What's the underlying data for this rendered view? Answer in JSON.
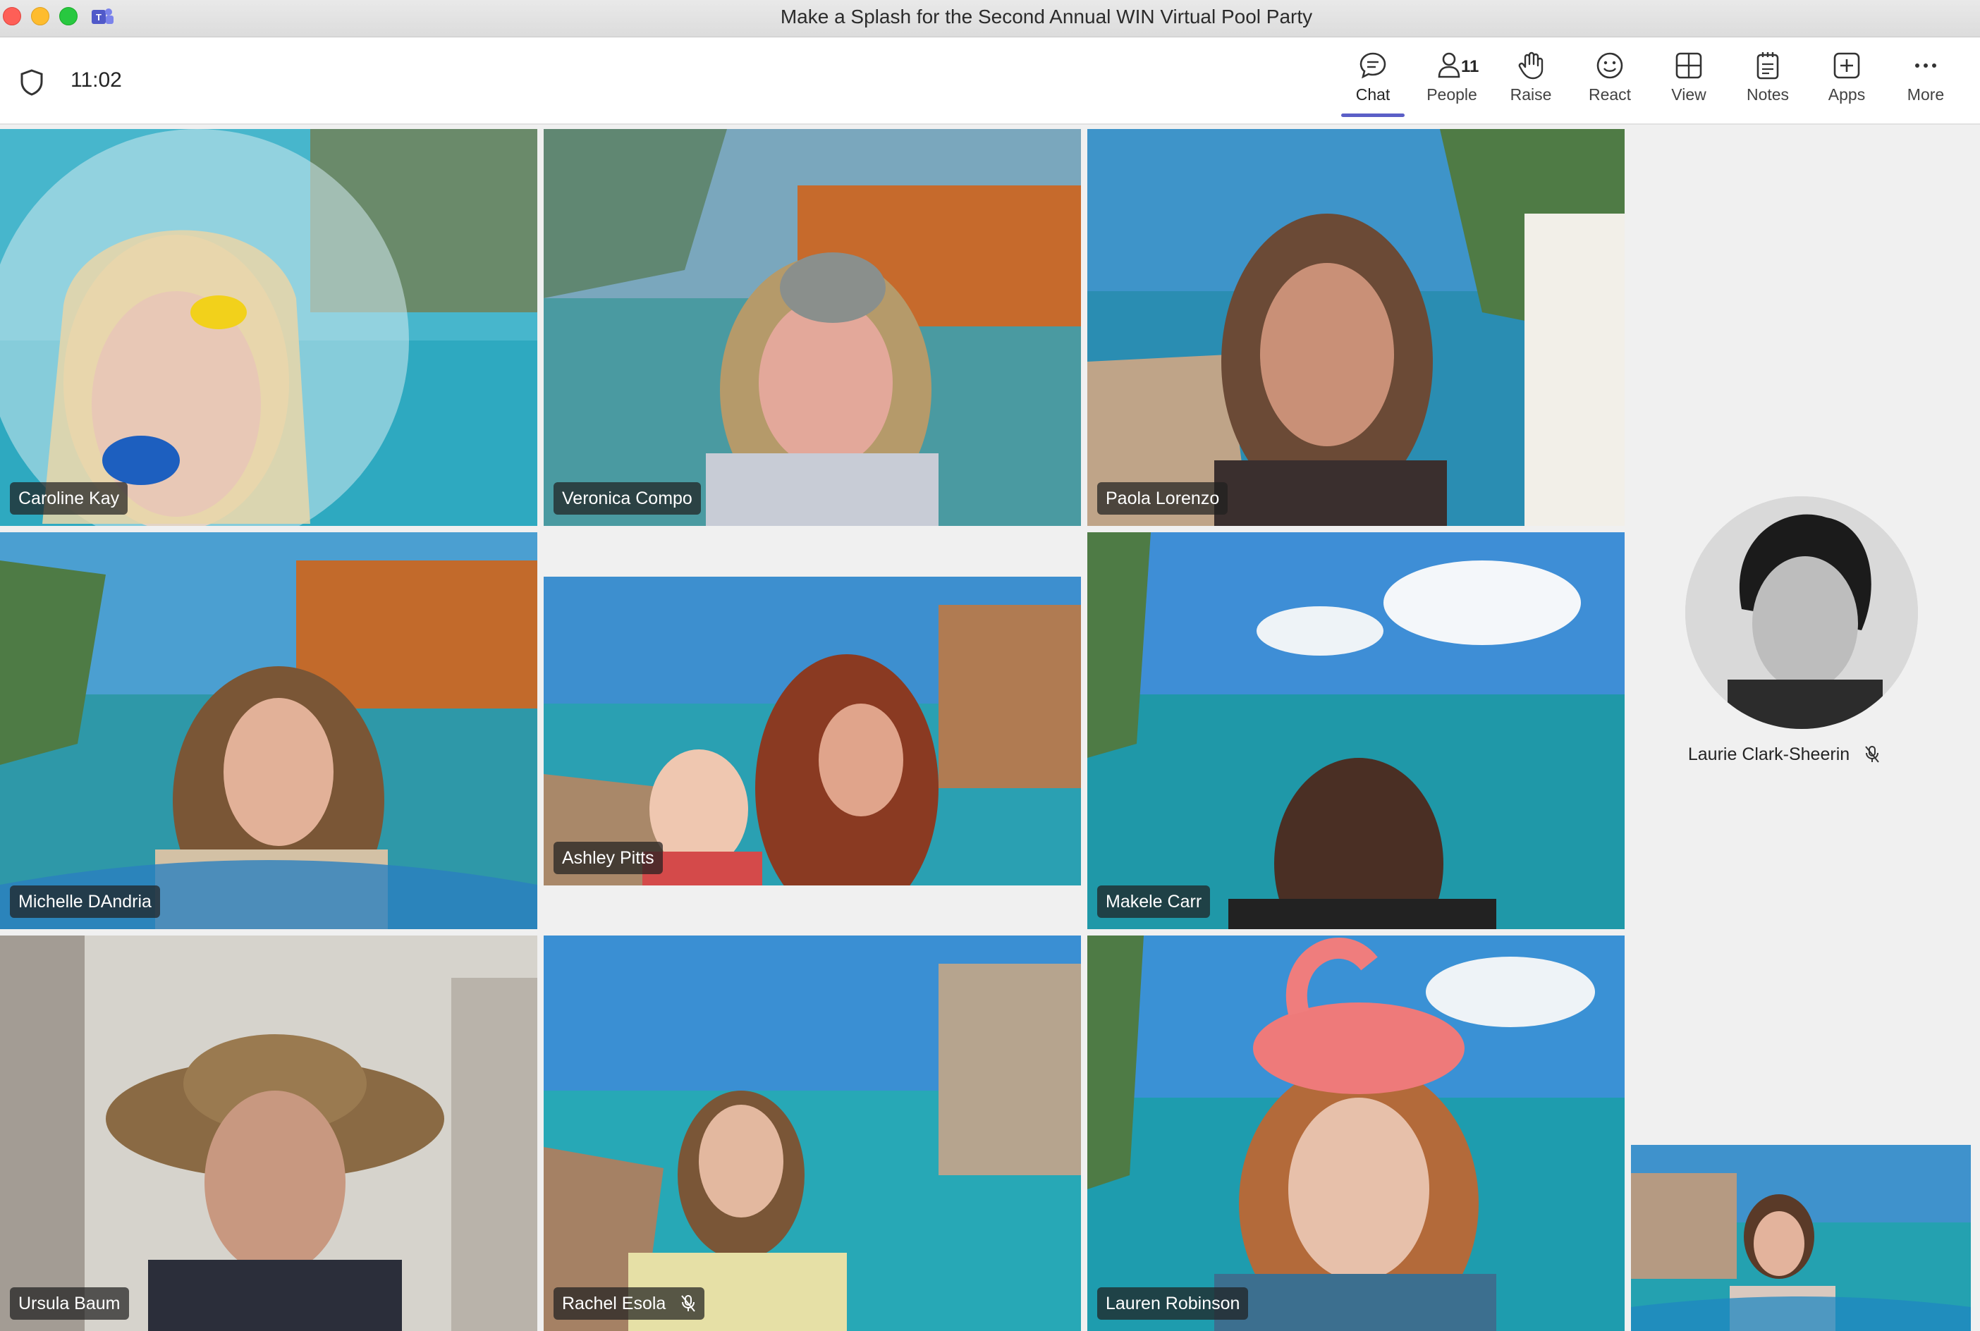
{
  "window": {
    "title": "Make a Splash for the Second Annual WIN Virtual Pool Party"
  },
  "toolbar": {
    "elapsed_time": "11:02",
    "people_count": "11",
    "buttons": [
      {
        "label": "Chat",
        "icon": "chat-icon",
        "active": true
      },
      {
        "label": "People",
        "icon": "people-icon"
      },
      {
        "label": "Raise",
        "icon": "raise-hand-icon"
      },
      {
        "label": "React",
        "icon": "react-icon"
      },
      {
        "label": "View",
        "icon": "view-grid-icon"
      },
      {
        "label": "Notes",
        "icon": "notes-icon"
      },
      {
        "label": "Apps",
        "icon": "apps-icon"
      },
      {
        "label": "More",
        "icon": "more-icon"
      }
    ]
  },
  "participants": [
    {
      "name": "Caroline Kay",
      "muted": false,
      "speaking": false
    },
    {
      "name": "Veronica Compo",
      "muted": false,
      "speaking": false
    },
    {
      "name": "Paola Lorenzo",
      "muted": false,
      "speaking": true
    },
    {
      "name": "Michelle DAndria",
      "muted": false,
      "speaking": true
    },
    {
      "name": "Ashley Pitts",
      "muted": false,
      "speaking": false
    },
    {
      "name": "Makele Carr",
      "muted": false,
      "speaking": false
    },
    {
      "name": "Ursula Baum",
      "muted": false,
      "speaking": false
    },
    {
      "name": "Rachel Esola",
      "muted": true,
      "speaking": false
    },
    {
      "name": "Lauren Robinson",
      "muted": false,
      "speaking": false
    }
  ],
  "side_participant": {
    "name": "Laurie Clark-Sheerin",
    "muted": true
  },
  "colors": {
    "accent": "#5b5fc7",
    "toolbar_bg": "#ffffff",
    "name_tag_bg": "#202020"
  }
}
